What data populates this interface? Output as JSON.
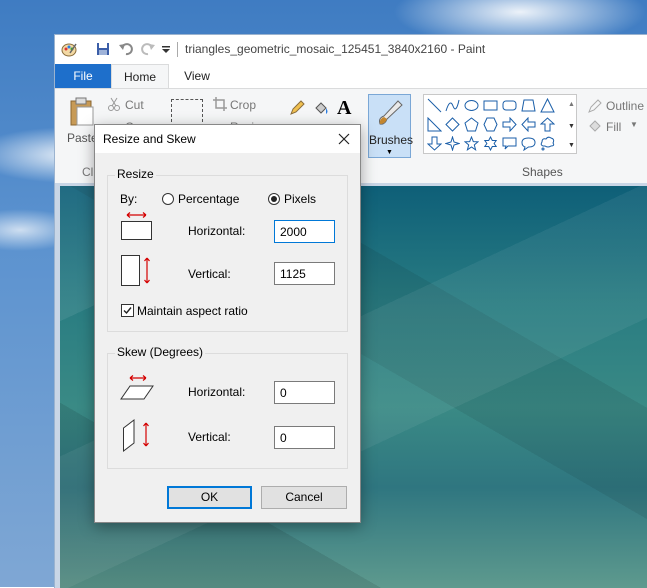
{
  "window": {
    "title": "triangles_geometric_mosaic_125451_3840x2160 - Paint"
  },
  "tabs": {
    "file": "File",
    "home": "Home",
    "view": "View"
  },
  "ribbon": {
    "paste": "Paste",
    "clipboard_group": "Cli",
    "cut": "Cut",
    "copy": "Copy",
    "crop": "Crop",
    "resize": "Resize",
    "brushes": "Brushes",
    "outline": "Outline",
    "fill": "Fill",
    "shapes_group": "Shapes"
  },
  "dialog": {
    "title": "Resize and Skew",
    "resize": {
      "legend": "Resize",
      "by_label": "By:",
      "percentage_label": "Percentage",
      "pixels_label": "Pixels",
      "selected": "Pixels",
      "horizontal_label": "Horizontal:",
      "horizontal_value": "2000",
      "vertical_label": "Vertical:",
      "vertical_value": "1125",
      "maintain_label": "Maintain aspect ratio",
      "maintain_checked": true
    },
    "skew": {
      "legend": "Skew (Degrees)",
      "horizontal_label": "Horizontal:",
      "horizontal_value": "0",
      "vertical_label": "Vertical:",
      "vertical_value": "0"
    },
    "ok_label": "OK",
    "cancel_label": "Cancel"
  },
  "colors": {
    "accent": "#0078d7",
    "file_tab": "#1e6fcb",
    "arrow_red": "#d40000"
  }
}
